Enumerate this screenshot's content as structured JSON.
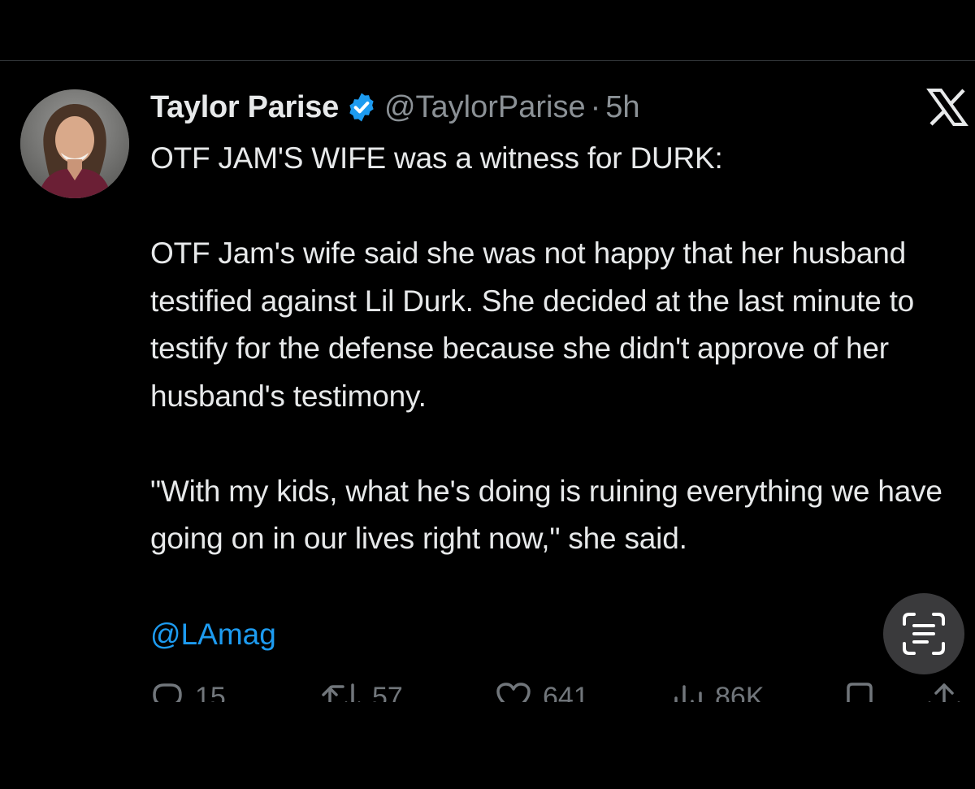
{
  "author": {
    "name": "Taylor Parise",
    "handle": "@TaylorParise",
    "separator": "·",
    "time": "5h",
    "verified": true
  },
  "tweet": {
    "text": "OTF JAM'S WIFE was a witness for DURK:\n\nOTF Jam's wife said she was not happy that her husband testified against Lil Durk. She decided at the last minute to testify for the defense because she didn't approve of her husband's testimony.\n\n\"With my kids, what he's doing is ruining everything we have going on in our lives right now,\" she said.",
    "mention": "@LAmag"
  },
  "actions": {
    "replies": "15",
    "reposts": "57",
    "likes": "641",
    "views": "86K"
  },
  "icons": {
    "brand": "x-logo-icon",
    "verified": "verified-badge-icon",
    "lens": "live-text-scan-icon",
    "reply": "reply-icon",
    "repost": "repost-icon",
    "like": "heart-icon",
    "views": "views-icon",
    "bookmark": "bookmark-icon",
    "share": "share-icon"
  },
  "colors": {
    "background": "#000000",
    "text": "#e7e9ea",
    "secondary": "#8b9196",
    "accent": "#1d9bf0"
  }
}
